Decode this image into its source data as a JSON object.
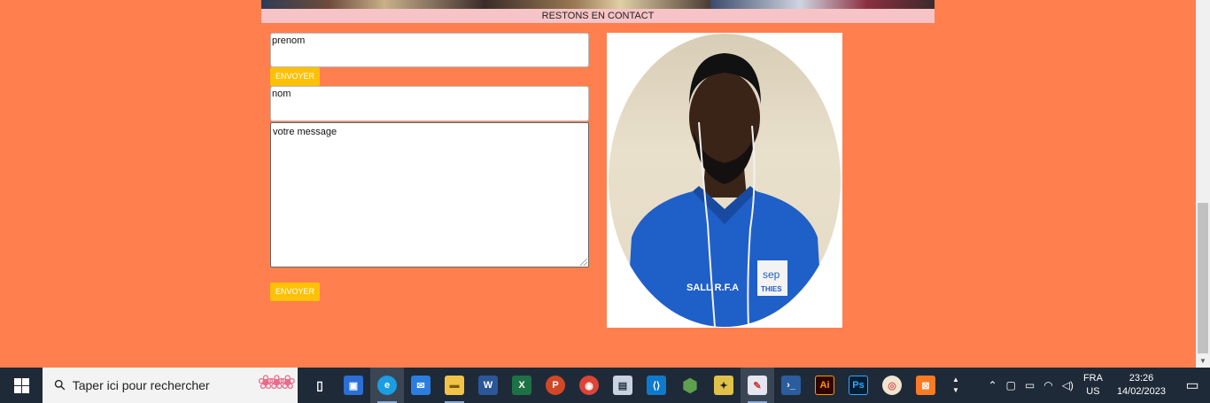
{
  "contact": {
    "heading": "RESTONS EN CONTACT",
    "prenom_value": "prenom",
    "nom_value": "nom",
    "message_value": "votre message",
    "send_label_1": "ENVOYER",
    "send_label_2": "ENVOYER"
  },
  "photo": {
    "shirt_text": "SALL R.F.A",
    "badge_top": "sep",
    "badge_bottom": "THIES"
  },
  "colors": {
    "page_bg": "#ff7f4f",
    "contact_bar": "#f6c3c6",
    "button": "#ffc107"
  },
  "taskbar": {
    "search_placeholder": "Taper ici pour rechercher",
    "apps": [
      {
        "name": "task-view-icon",
        "glyph": "▯"
      },
      {
        "name": "microsoft-store-icon",
        "glyph": "▣"
      },
      {
        "name": "edge-icon",
        "glyph": "e"
      },
      {
        "name": "mail-icon",
        "glyph": "✉"
      },
      {
        "name": "file-explorer-icon",
        "glyph": "▬"
      },
      {
        "name": "word-icon",
        "glyph": "W"
      },
      {
        "name": "excel-icon",
        "glyph": "X"
      },
      {
        "name": "powerpoint-icon",
        "glyph": "P"
      },
      {
        "name": "chrome-icon",
        "glyph": "◉"
      },
      {
        "name": "network-app-icon",
        "glyph": "▤"
      },
      {
        "name": "vscode-icon",
        "glyph": "⟨⟩"
      },
      {
        "name": "nodejs-icon",
        "glyph": "⬢"
      },
      {
        "name": "app-icon",
        "glyph": "✦"
      },
      {
        "name": "paint-icon",
        "glyph": "✎"
      },
      {
        "name": "powershell-icon",
        "glyph": "›_"
      },
      {
        "name": "illustrator-icon",
        "glyph": "Ai"
      },
      {
        "name": "photoshop-icon",
        "glyph": "Ps"
      },
      {
        "name": "media-player-icon",
        "glyph": "◎"
      },
      {
        "name": "xampp-icon",
        "glyph": "⊠"
      }
    ],
    "lang_top": "FRA",
    "lang_bottom": "US",
    "time": "23:26",
    "date": "14/02/2023"
  }
}
